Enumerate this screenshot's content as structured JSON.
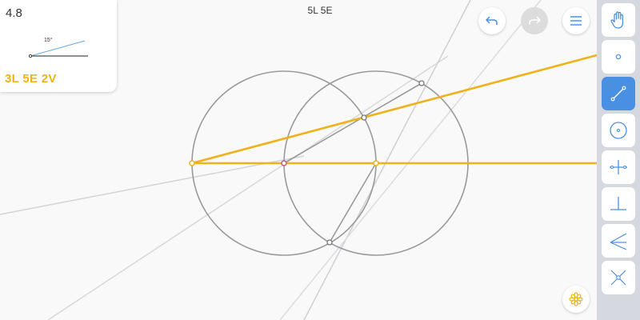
{
  "level": {
    "number": "4.8",
    "goal_angle": "15°",
    "goals": "3L  5E  2V"
  },
  "move_counter": "5L  5E",
  "colors": {
    "accent_yellow": "#f0b21a",
    "active_tool_blue": "#4a90e2",
    "construction_gray": "#9a9a9a",
    "faint_line": "#d4d4d8",
    "toolbar_bg": "#d5d8de"
  },
  "top_buttons": [
    {
      "name": "undo-icon",
      "enabled": true
    },
    {
      "name": "redo-icon",
      "enabled": false
    },
    {
      "name": "menu-icon",
      "enabled": true
    }
  ],
  "tools": [
    {
      "name": "hand-icon",
      "active": false
    },
    {
      "name": "point-icon",
      "active": false
    },
    {
      "name": "line-icon",
      "active": true
    },
    {
      "name": "circle-icon",
      "active": false
    },
    {
      "name": "perpendicular-bisector-icon",
      "active": false
    },
    {
      "name": "perpendicular-icon",
      "active": false
    },
    {
      "name": "angle-bisector-icon",
      "active": false
    },
    {
      "name": "intersect-icon",
      "active": false
    }
  ],
  "hint_button": {
    "name": "hint-flower-icon"
  }
}
